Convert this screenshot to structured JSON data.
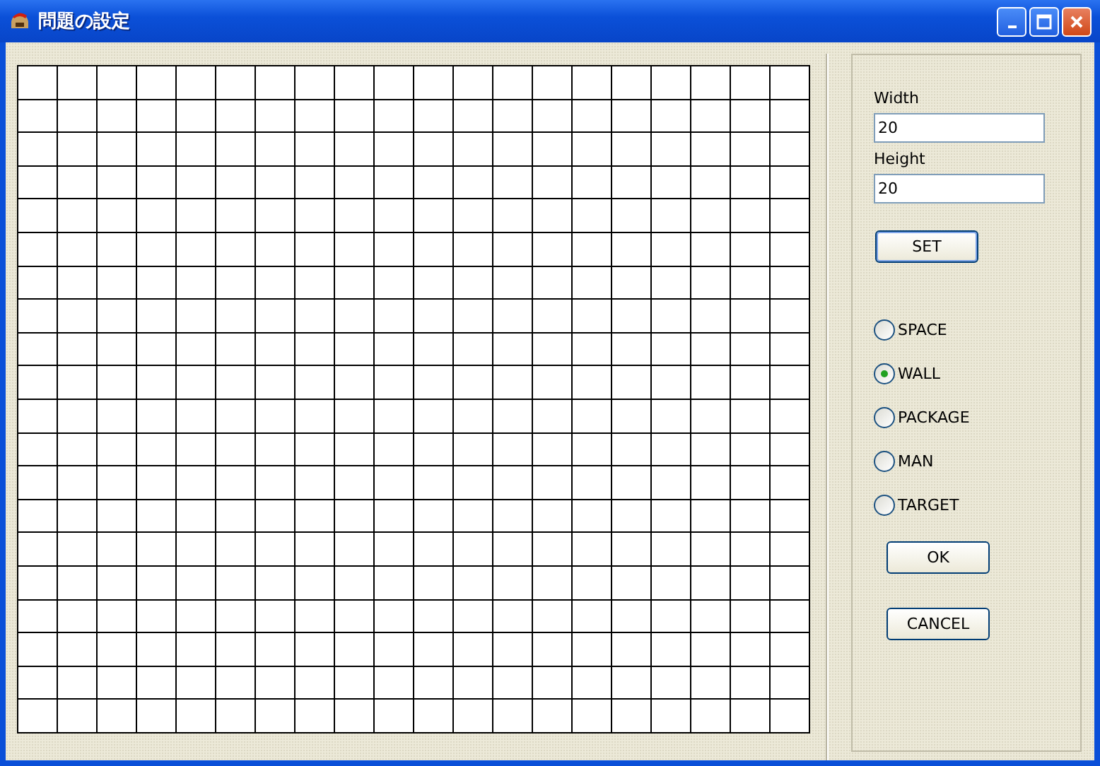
{
  "window": {
    "title": "問題の設定"
  },
  "fields": [
    {
      "label": "Width",
      "value": "20"
    },
    {
      "label": "Height",
      "value": "20"
    }
  ],
  "set_button": "SET",
  "tiles": [
    {
      "label": "SPACE",
      "selected": false
    },
    {
      "label": "WALL",
      "selected": true
    },
    {
      "label": "PACKAGE",
      "selected": false
    },
    {
      "label": "MAN",
      "selected": false
    },
    {
      "label": "TARGET",
      "selected": false
    }
  ],
  "buttons": [
    "OK",
    "CANCEL"
  ]
}
